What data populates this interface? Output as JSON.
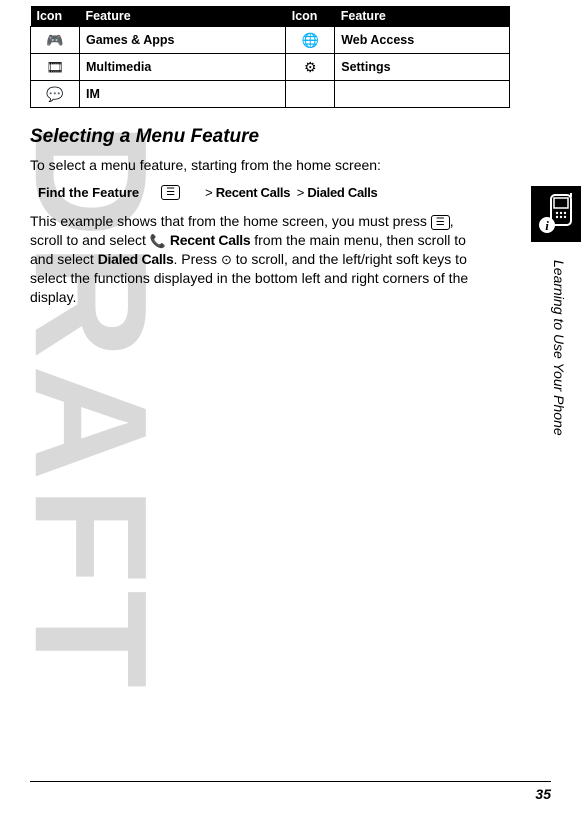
{
  "watermark": "DRAFT",
  "table": {
    "headers": [
      "Icon",
      "Feature",
      "Icon",
      "Feature"
    ],
    "rows": [
      {
        "icon1": "games-apps-icon",
        "glyph1": "🎮",
        "feat1": "Games & Apps",
        "icon2": "web-access-icon",
        "glyph2": "🌐",
        "feat2": "Web Access"
      },
      {
        "icon1": "multimedia-icon",
        "glyph1": "🎞",
        "feat1": "Multimedia",
        "icon2": "settings-icon",
        "glyph2": "⚙",
        "feat2": "Settings"
      },
      {
        "icon1": "im-icon",
        "glyph1": "💬",
        "feat1": "IM",
        "icon2": "",
        "glyph2": "",
        "feat2": ""
      }
    ]
  },
  "section_title": "Selecting a Menu Feature",
  "intro": "To select a menu feature, starting from the home screen:",
  "find": {
    "label": "Find the Feature",
    "menu_key": "☰",
    "path1": "Recent Calls",
    "path2": "Dialed Calls",
    "sep": ">"
  },
  "body": {
    "p1a": "This example shows that from the home screen, you must press ",
    "menu_key": "☰",
    "p1b": ", scroll to and select ",
    "recent_icon": "📞",
    "recent_label": "Recent Calls",
    "p1c": " from the main menu, then scroll to and select ",
    "dialed_label": "Dialed Calls",
    "p1d": ". Press ",
    "nav_key": "⊙",
    "p1e": " to scroll, and the left/right soft keys to select the functions displayed in the bottom left and right corners of the display."
  },
  "side_label": "Learning to Use Your Phone",
  "page_number": "35"
}
